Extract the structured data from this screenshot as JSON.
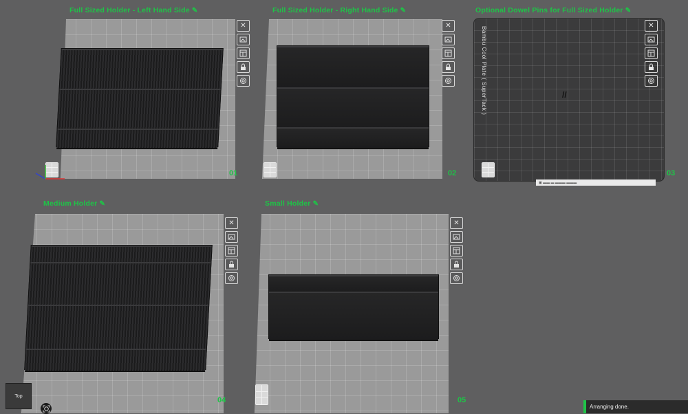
{
  "plates": [
    {
      "title": "Full Sized Holder - Left Hand Side",
      "number": "01"
    },
    {
      "title": "Full Sized Holder - Right Hand Side",
      "number": "02"
    },
    {
      "title": "Optional Dowel Pins for Full Sized Holder",
      "number": "03",
      "bed_label": "Bambu Cool Plate ( SuperTack )"
    },
    {
      "title": "Medium Holder",
      "number": "04"
    },
    {
      "title": "Small Holder",
      "number": "05"
    }
  ],
  "plate_tools": [
    "close-icon",
    "auto-orient-icon",
    "arrange-icon",
    "lock-icon",
    "settings-icon"
  ],
  "view_cube": {
    "label": "Top"
  },
  "status": {
    "message": "Arranging done."
  },
  "colors": {
    "accent": "#1ec447",
    "canvas": "#5f5f60",
    "bed": "#9a9a9a",
    "model": "#1f1f20"
  }
}
